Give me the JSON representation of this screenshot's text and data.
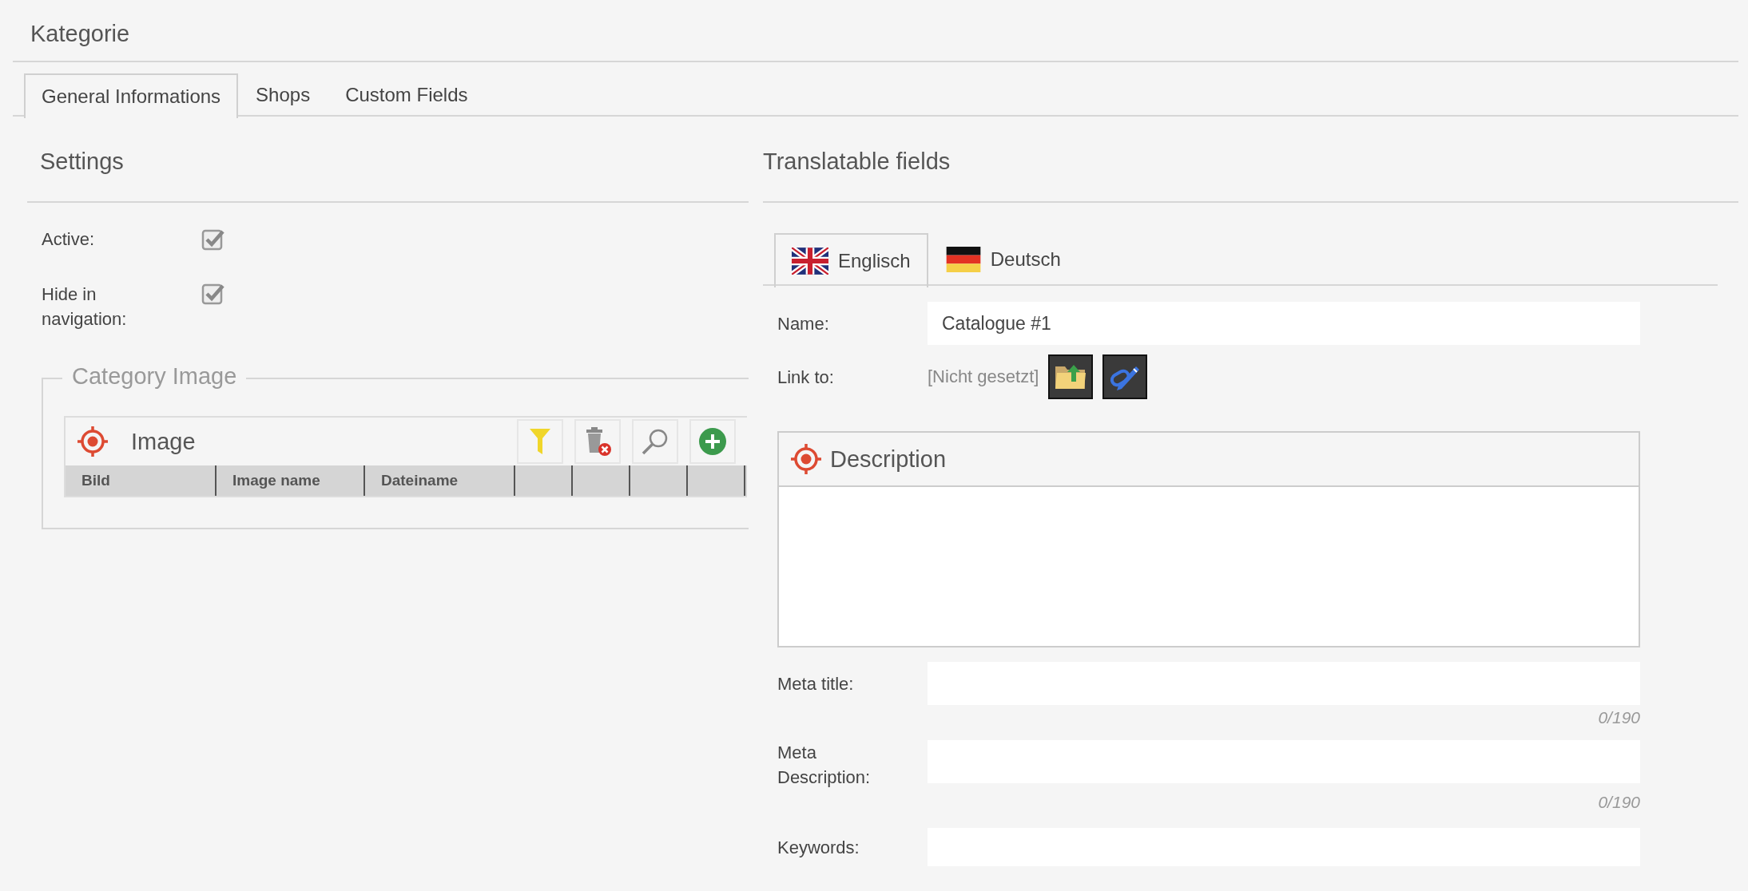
{
  "page_title": "Kategorie",
  "tabs": [
    {
      "label": "General Informations",
      "selected": true
    },
    {
      "label": "Shops",
      "selected": false
    },
    {
      "label": "Custom Fields",
      "selected": false
    }
  ],
  "settings": {
    "title": "Settings",
    "fields": [
      {
        "label": "Active:",
        "checked": true
      },
      {
        "label": "Hide in navigation:",
        "checked": true
      }
    ],
    "category_image": {
      "legend": "Category Image",
      "panel_title": "Image",
      "columns": [
        "Bild",
        "Image name",
        "Dateiname"
      ]
    }
  },
  "translatable": {
    "title": "Translatable fields",
    "languages": [
      {
        "label": "Englisch",
        "selected": true,
        "kind": "uk"
      },
      {
        "label": "Deutsch",
        "selected": false,
        "kind": "de"
      }
    ],
    "name": {
      "label": "Name:",
      "value": "Catalogue #1"
    },
    "link_to": {
      "label": "Link to:",
      "value": "[Nicht gesetzt]"
    },
    "description": {
      "title": "Description"
    },
    "meta_fields": [
      {
        "label": "Meta title:",
        "counter": "0/190"
      },
      {
        "label": "Meta Description:",
        "counter": "0/190"
      },
      {
        "label": "Keywords:"
      }
    ]
  }
}
